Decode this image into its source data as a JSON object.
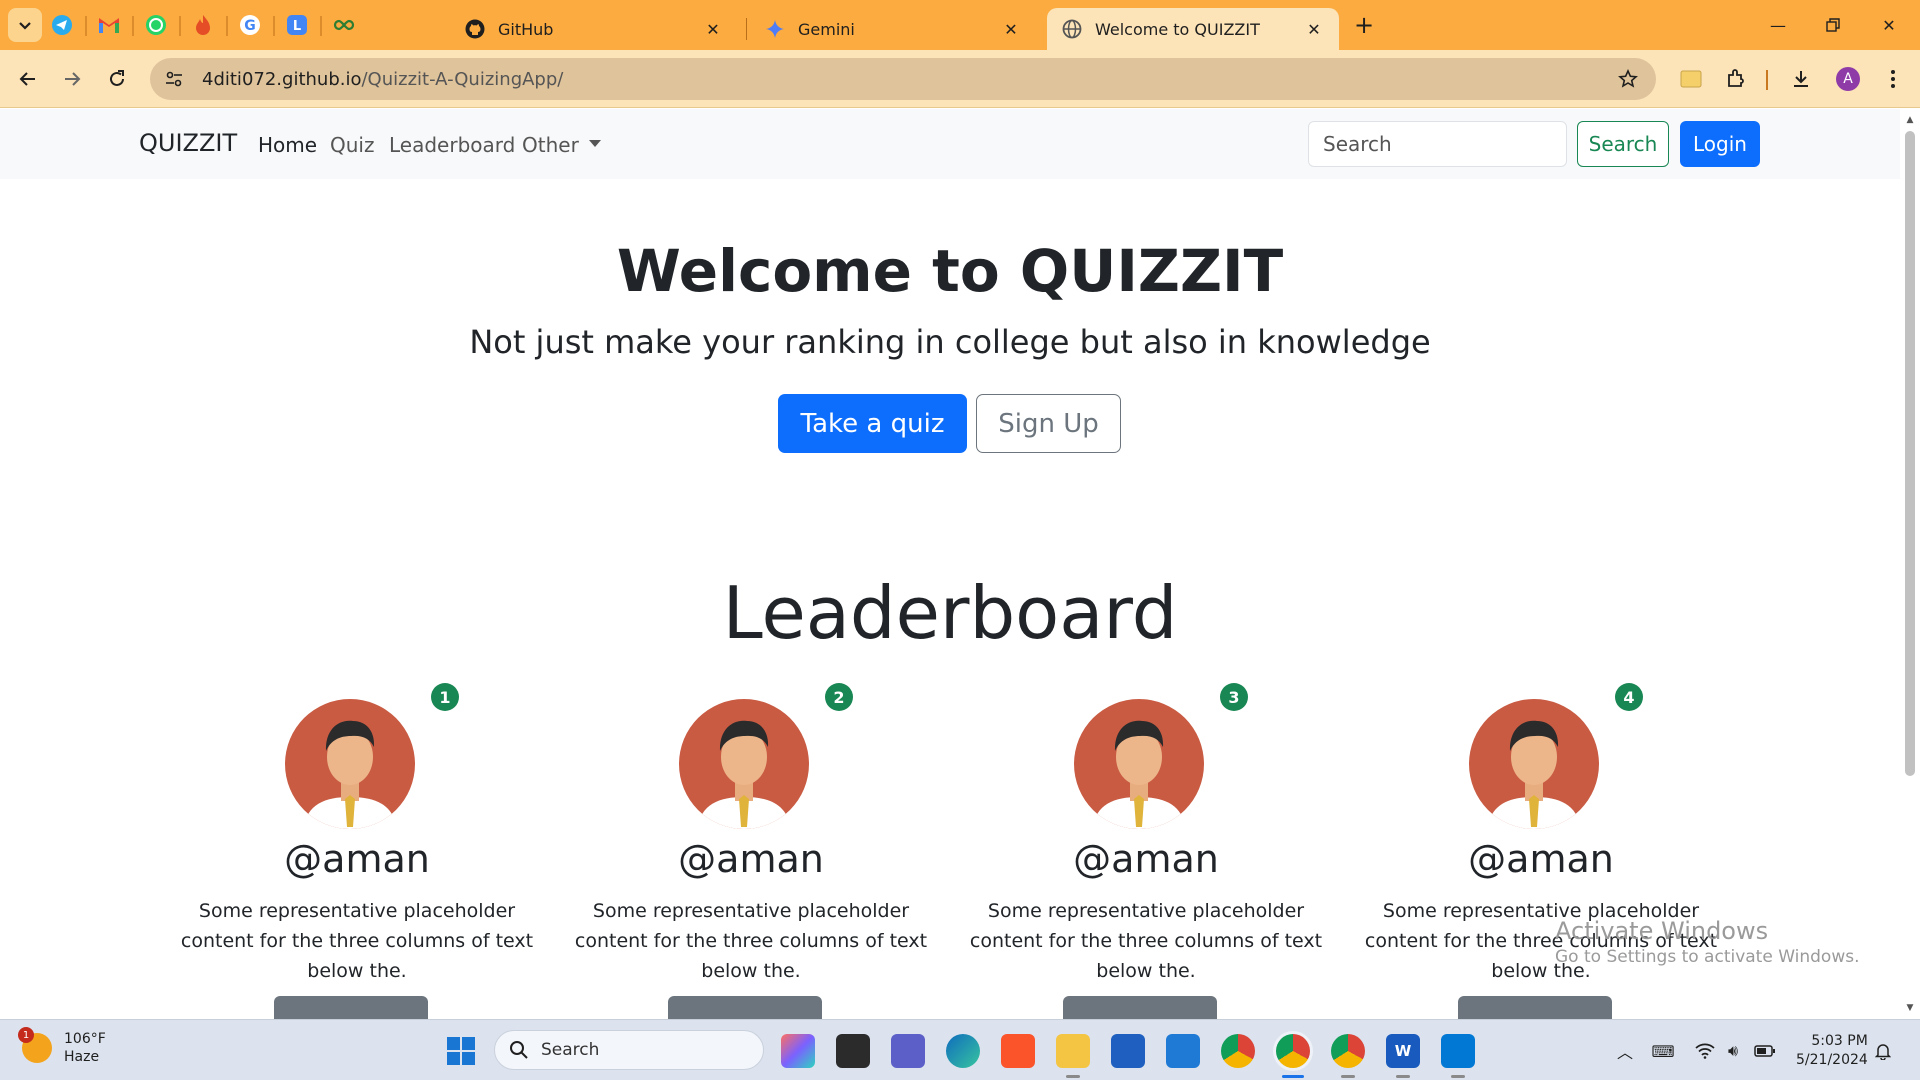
{
  "browser": {
    "tabs": [
      {
        "title": "GitHub",
        "icon": "github-icon"
      },
      {
        "title": "Gemini",
        "icon": "gemini-icon"
      },
      {
        "title": "Welcome to QUIZZIT",
        "icon": "globe-icon",
        "active": true
      }
    ],
    "pinned_tabs": [
      "telegram-icon",
      "gmail-icon",
      "whatsapp-icon",
      "flame-icon",
      "google-icon",
      "lens-icon",
      "infinity-icon"
    ],
    "url_host": "4diti072.github.io",
    "url_path": "/Quizzit-A-QuizingApp/",
    "profile_initial": "A"
  },
  "site": {
    "brand": "QUIZZIT",
    "nav": [
      "Home",
      "Quiz",
      "Leaderboard",
      "Other"
    ],
    "search_placeholder": "Search",
    "search_button": "Search",
    "login_button": "Login"
  },
  "hero": {
    "title": "Welcome to QUIZZIT",
    "subtitle": "Not just make your ranking in college but also in knowledge",
    "primary_button": "Take a quiz",
    "secondary_button": "Sign Up"
  },
  "leaderboard": {
    "title": "Leaderboard",
    "cards": [
      {
        "rank": "1",
        "username": "@aman",
        "description": "Some representative placeholder content for the three columns of text below the."
      },
      {
        "rank": "2",
        "username": "@aman",
        "description": "Some representative placeholder content for the three columns of text below the."
      },
      {
        "rank": "3",
        "username": "@aman",
        "description": "Some representative placeholder content for the three columns of text below the."
      },
      {
        "rank": "4",
        "username": "@aman",
        "description": "Some representative placeholder content for the three columns of text below the."
      }
    ]
  },
  "watermark": {
    "line1": "Activate Windows",
    "line2": "Go to Settings to activate Windows."
  },
  "taskbar": {
    "temperature": "106°F",
    "condition": "Haze",
    "weather_badge": "1",
    "search_placeholder": "Search",
    "time": "5:03 PM",
    "date": "5/21/2024",
    "word_letter": "W"
  },
  "colors": {
    "primary": "#0d6efd",
    "success": "#198754",
    "browser_frame": "#fbab3f",
    "avatar_bg": "#c95b43"
  }
}
